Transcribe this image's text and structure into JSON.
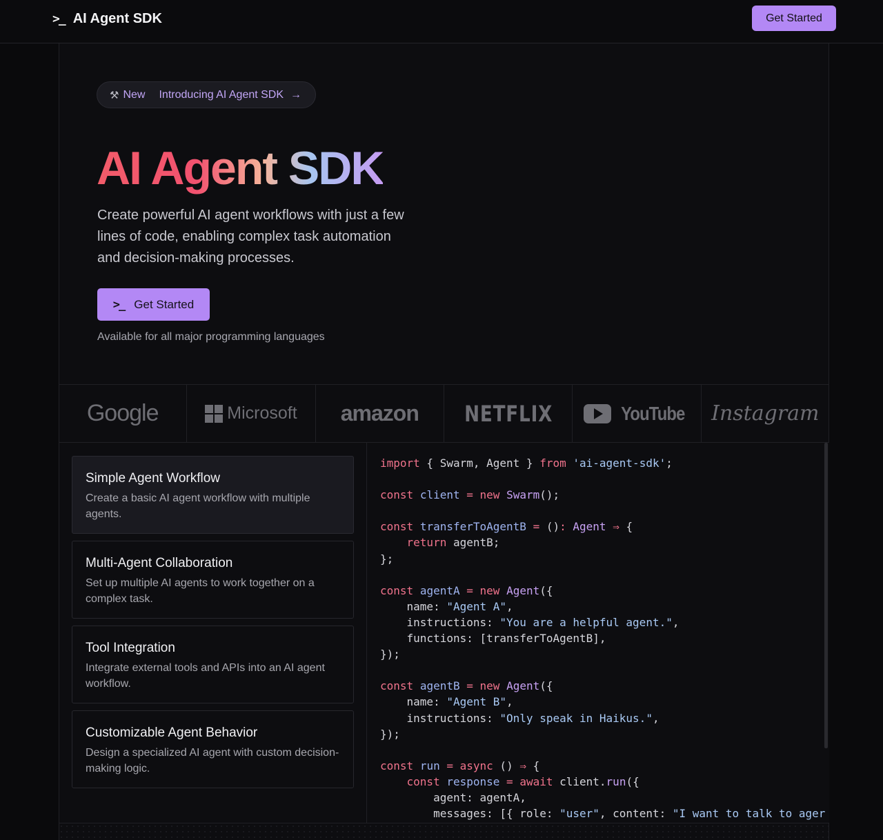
{
  "navbar": {
    "brand_icon": ">_",
    "brand_name": "AI Agent SDK",
    "cta_label": "Get Started"
  },
  "hero": {
    "pill": {
      "badge": "New",
      "text": "Introducing AI Agent SDK",
      "arrow": "→"
    },
    "title": "AI Agent SDK",
    "subtitle": "Create powerful AI agent workflows with just a few lines of code, enabling complex task automation and decision-making processes.",
    "cta_icon": ">_",
    "cta_label": "Get Started",
    "availability": "Available for all major programming languages"
  },
  "logos": [
    {
      "name": "Google"
    },
    {
      "name": "Microsoft"
    },
    {
      "name": "amazon"
    },
    {
      "name": "NETFLIX"
    },
    {
      "name": "YouTube"
    },
    {
      "name": "Instagram"
    }
  ],
  "features": [
    {
      "title": "Simple Agent Workflow",
      "desc": "Create a basic AI agent workflow with multiple agents.",
      "active": true
    },
    {
      "title": "Multi-Agent Collaboration",
      "desc": "Set up multiple AI agents to work together on a complex task.",
      "active": false
    },
    {
      "title": "Tool Integration",
      "desc": "Integrate external tools and APIs into an AI agent workflow.",
      "active": false
    },
    {
      "title": "Customizable Agent Behavior",
      "desc": "Design a specialized AI agent with custom decision-making logic.",
      "active": false
    }
  ],
  "code": {
    "language": "typescript",
    "lines": [
      "import { Swarm, Agent } from 'ai-agent-sdk';",
      "",
      "const client = new Swarm();",
      "",
      "const transferToAgentB = (): Agent ⇒ {",
      "    return agentB;",
      "};",
      "",
      "const agentA = new Agent({",
      "    name: \"Agent A\",",
      "    instructions: \"You are a helpful agent.\",",
      "    functions: [transferToAgentB],",
      "});",
      "",
      "const agentB = new Agent({",
      "    name: \"Agent B\",",
      "    instructions: \"Only speak in Haikus.\",",
      "});",
      "",
      "const run = async () ⇒ {",
      "    const response = await client.run({",
      "        agent: agentA,",
      "        messages: [{ role: \"user\", content: \"I want to talk to ager"
    ]
  },
  "colors": {
    "accent": "#b388f5",
    "background": "#0a0a0c",
    "keyword": "#f0738c",
    "identifier": "#9fb4f0",
    "string": "#a9c9f4"
  }
}
